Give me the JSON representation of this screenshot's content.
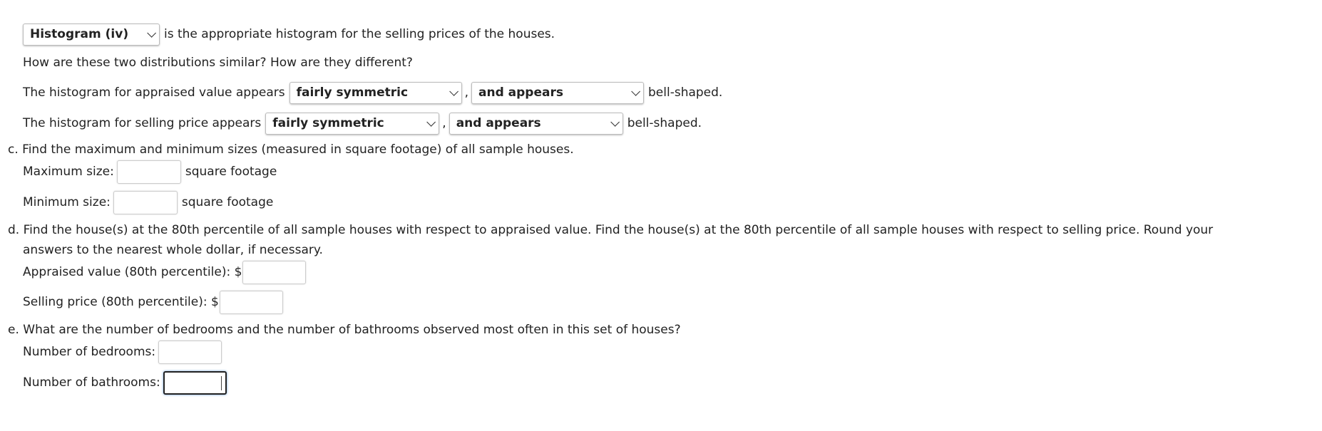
{
  "intro": {
    "histogram_select": "Histogram (iv)",
    "histogram_text": "is the appropriate histogram for the selling prices of the houses.",
    "question": "How are these two distributions similar? How are they different?",
    "appraised": {
      "prefix": "The histogram for appraised value appears",
      "shape": "fairly symmetric",
      "comma": ",",
      "bell": "and appears",
      "suffix": "bell-shaped."
    },
    "selling": {
      "prefix": "The histogram for selling price appears",
      "shape": "fairly symmetric",
      "comma": ",",
      "bell": "and appears",
      "suffix": "bell-shaped."
    }
  },
  "c": {
    "label": "c.",
    "question": "Find the maximum and minimum sizes (measured in square footage) of all sample houses.",
    "max_label": "Maximum size:",
    "max_value": "",
    "max_unit": "square footage",
    "min_label": "Minimum size:",
    "min_value": "",
    "min_unit": "square footage"
  },
  "d": {
    "label": "d.",
    "question_line1": "Find the house(s) at the 80th percentile of all sample houses with respect to appraised value. Find the house(s) at the 80th percentile of all sample houses with respect to selling price. Round your",
    "question_line2": "answers to the nearest whole dollar, if necessary.",
    "appraised_label": "Appraised value (80th percentile): $",
    "appraised_value": "",
    "selling_label": "Selling price (80th percentile): $",
    "selling_value": ""
  },
  "e": {
    "label": "e.",
    "question": "What are the number of bedrooms and the number of bathrooms observed most often in this set of houses?",
    "bedrooms_label": "Number of bedrooms:",
    "bedrooms_value": "",
    "bathrooms_label": "Number of bathrooms:",
    "bathrooms_value": ""
  }
}
